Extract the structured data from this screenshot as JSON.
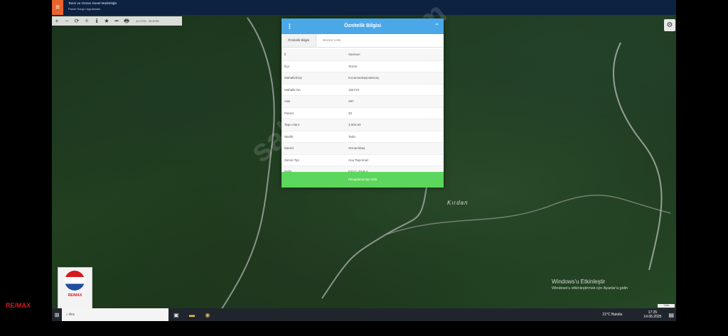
{
  "header": {
    "menu_icon": "hamburger-icon",
    "title_line1": "Tarım ve Orman Genel Müdürlüğü",
    "title_line2": "Parsel Sorgu Uygulaması"
  },
  "map_toolbar": {
    "tools": [
      "+",
      "−",
      "⟳",
      "✧",
      "ℹ",
      "★",
      "━",
      "🖶"
    ],
    "coordinate": "41.0738 · 36.6789"
  },
  "panel": {
    "title": "Öznitelik Bilgisi",
    "menu_icon": "dots-vertical-icon",
    "close_icon": "chevron-up-icon",
    "tabs": [
      "Öznitelik Bilgisi",
      "Benzer Liste"
    ],
    "rows": [
      {
        "key": "İl",
        "value": "Samsun"
      },
      {
        "key": "İlçe",
        "value": "Terme"
      },
      {
        "key": "Mahalle/Köy",
        "value": "Kocamanbaşmakmaç"
      },
      {
        "key": "Mahalle No",
        "value": "164710"
      },
      {
        "key": "Ada",
        "value": "287"
      },
      {
        "key": "Parsel",
        "value": "33"
      },
      {
        "key": "Tapu Alanı",
        "value": "3.604,93"
      },
      {
        "key": "Nitelik",
        "value": "Tarla"
      },
      {
        "key": "Mevkii",
        "value": "Ormanlıbaş"
      },
      {
        "key": "Zemin Tipi",
        "value": "Ana Taşınmaz"
      },
      {
        "key": "Pafta",
        "value": "F37-C-20-B-4"
      }
    ],
    "button_label": "Hesaplama'dan tıkla"
  },
  "map": {
    "place_label": "Kırdan",
    "watermark": "sahibinden.com",
    "activate_title": "Windows'u Etkinleştir",
    "activate_body": "Windows'u etkinleştirmek için Ayarlar'a gidin",
    "scale_label": "1 km"
  },
  "logo": {
    "brand": "RE/MAX",
    "sub": "RE/MAX",
    "caption": "PARLA"
  },
  "taskbar": {
    "search_placeholder": "Ara",
    "weather": "21°C  Bulutlu",
    "time": "17:25",
    "date": "14.06.2025"
  },
  "colors": {
    "panel_header": "#4aa8e8",
    "panel_button": "#5cd65c",
    "topbar": "#0d2140",
    "menu_accent": "#e8642c"
  }
}
